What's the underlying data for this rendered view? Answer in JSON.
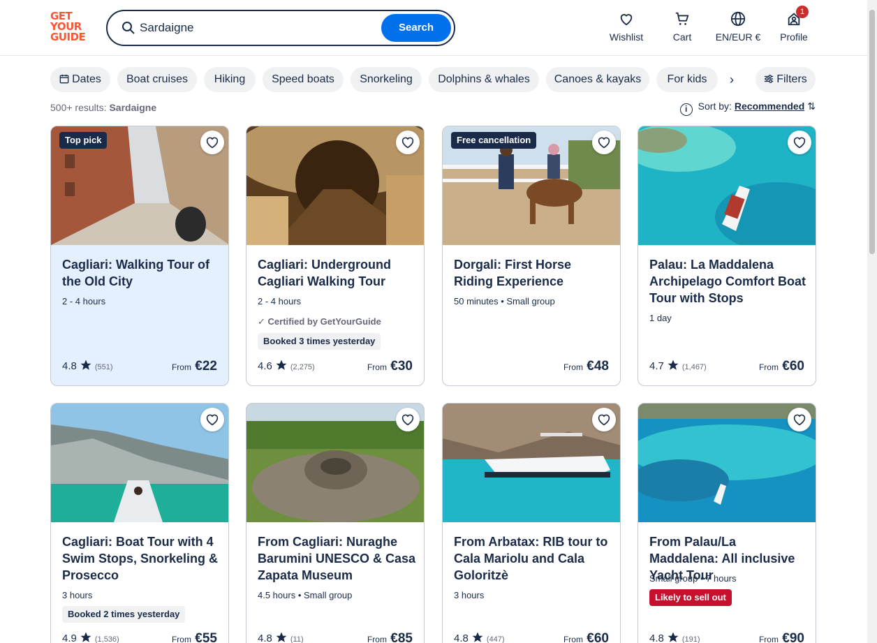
{
  "header": {
    "logo_lines": [
      "GET",
      "YOUR",
      "GUIDE"
    ],
    "search_value": "Sardaigne",
    "search_button": "Search",
    "nav": [
      {
        "label": "Wishlist",
        "icon": "heart-icon"
      },
      {
        "label": "Cart",
        "icon": "cart-icon"
      },
      {
        "label": "EN/EUR €",
        "icon": "globe-icon"
      },
      {
        "label": "Profile",
        "icon": "profile-icon",
        "badge": "1"
      }
    ]
  },
  "filters": {
    "chips": [
      "Dates",
      "Boat cruises",
      "Hiking",
      "Speed boats",
      "Snorkeling",
      "Dolphins & whales",
      "Canoes & kayaks",
      "For kids"
    ],
    "filters_label": "Filters"
  },
  "results": {
    "count": "500+ results:",
    "query": "Sardaigne",
    "sort_label": "Sort by:",
    "sort_value": "Recommended"
  },
  "cards": [
    {
      "tag": "Top pick",
      "title": "Cagliari: Walking Tour of the Old City",
      "meta": "2 - 4 hours",
      "rating": "4.8",
      "reviews": "(551)",
      "from": "From",
      "price": "€22"
    },
    {
      "title": "Cagliari: Underground Cagliari Walking Tour",
      "meta": "2 - 4 hours",
      "certified": "Certified by GetYourGuide",
      "booked": "Booked 3 times yesterday",
      "rating": "4.6",
      "reviews": "(2,275)",
      "from": "From",
      "price": "€30"
    },
    {
      "tag": "Free cancellation",
      "title": "Dorgali: First Horse Riding Experience",
      "meta": "50 minutes • Small group",
      "from": "From",
      "price": "€48"
    },
    {
      "title": "Palau: La Maddalena Archipelago Comfort Boat Tour with Stops",
      "meta": "1 day",
      "rating": "4.7",
      "reviews": "(1,467)",
      "from": "From",
      "price": "€60"
    },
    {
      "title": "Cagliari: Boat Tour with 4 Swim Stops, Snorkeling & Prosecco",
      "meta": "3 hours",
      "booked": "Booked 2 times yesterday",
      "rating": "4.9",
      "reviews": "(1,536)",
      "from": "From",
      "price": "€55"
    },
    {
      "title": "From Cagliari: Nuraghe Barumini UNESCO & Casa Zapata Museum",
      "meta": "4.5 hours • Small group",
      "rating": "4.8",
      "reviews": "(11)",
      "from": "From",
      "price": "€85"
    },
    {
      "title": "From Arbatax: RIB tour to Cala Mariolu and Cala Goloritzè",
      "meta": "3 hours",
      "rating": "4.8",
      "reviews": "(447)",
      "from": "From",
      "price": "€60"
    },
    {
      "title": "From Palau/La Maddalena: All inclusive Yacht Tour",
      "meta": "Small group • 7 hours",
      "sellout": "Likely to sell out",
      "rating": "4.8",
      "reviews": "(191)",
      "from": "From",
      "price": "€90"
    }
  ]
}
